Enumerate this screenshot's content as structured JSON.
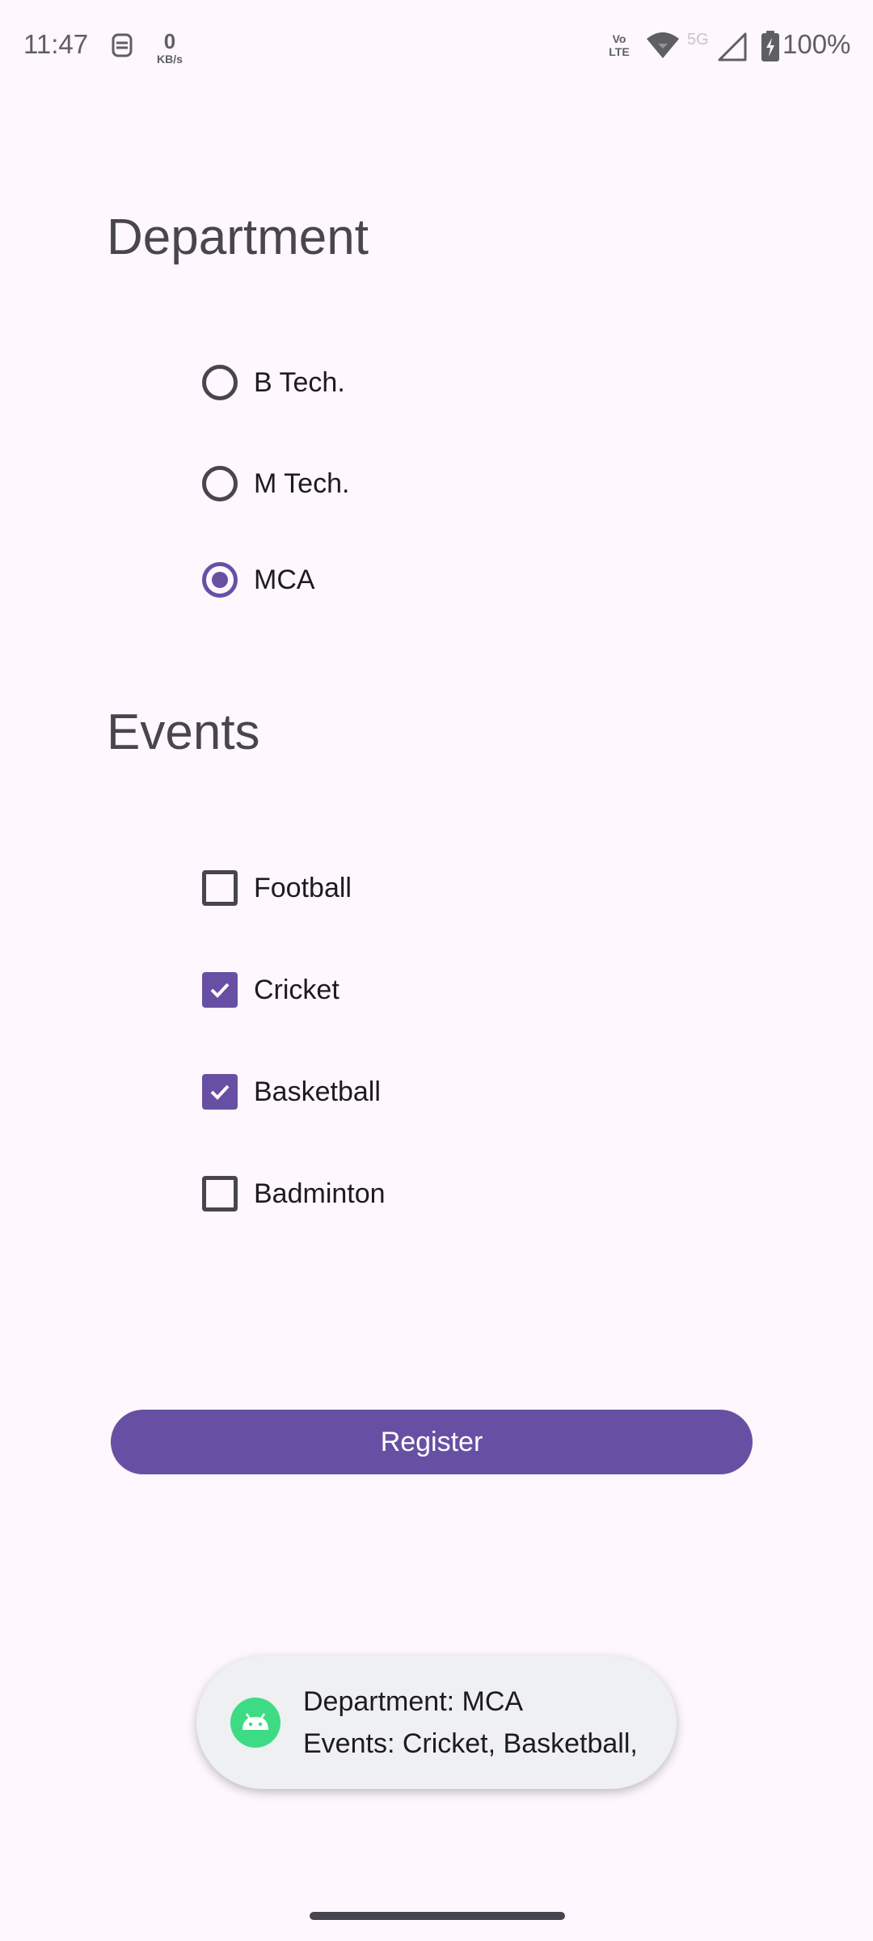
{
  "status_bar": {
    "time": "11:47",
    "speed_value": "0",
    "speed_unit": "KB/s",
    "volte_line1": "Vo",
    "volte_line2": "LTE",
    "network": "5G",
    "battery": "100%"
  },
  "department": {
    "title": "Department",
    "options": [
      {
        "label": "B Tech.",
        "checked": false
      },
      {
        "label": "M Tech.",
        "checked": false
      },
      {
        "label": "MCA",
        "checked": true
      }
    ]
  },
  "events": {
    "title": "Events",
    "options": [
      {
        "label": "Football",
        "checked": false
      },
      {
        "label": "Cricket",
        "checked": true
      },
      {
        "label": "Basketball",
        "checked": true
      },
      {
        "label": "Badminton",
        "checked": false
      }
    ]
  },
  "register_button": {
    "label": "Register"
  },
  "toast": {
    "line1": "Department: MCA",
    "line2": "Events: Cricket, Basketball,"
  },
  "colors": {
    "background": "#fef7fd",
    "accent": "#6750a4",
    "toast_background": "#eff0f1"
  }
}
